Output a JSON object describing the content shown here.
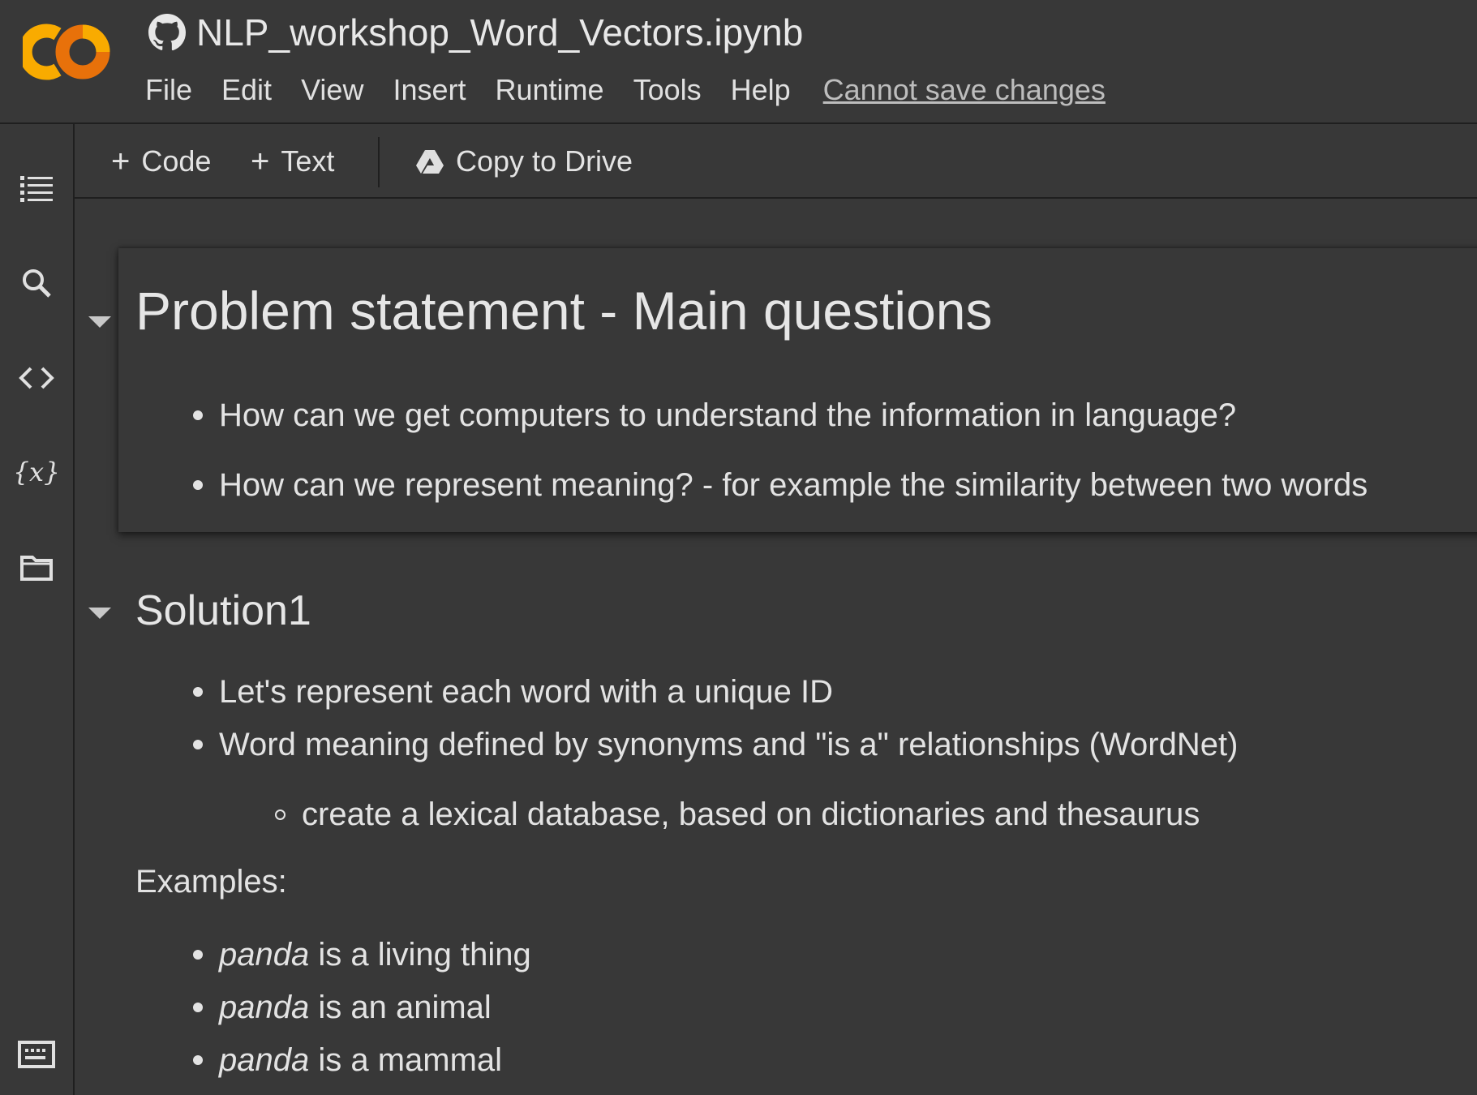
{
  "header": {
    "notebook_title": "NLP_workshop_Word_Vectors.ipynb",
    "logo_icon": "colab-logo-icon",
    "repo_icon": "github-icon",
    "menu": [
      "File",
      "Edit",
      "View",
      "Insert",
      "Runtime",
      "Tools",
      "Help"
    ],
    "save_status": "Cannot save changes"
  },
  "toolbar": {
    "code_label": "Code",
    "text_label": "Text",
    "drive_label": "Copy to Drive",
    "plus_glyph": "+"
  },
  "sidebar": {
    "icons": [
      "table-of-contents-icon",
      "search-icon",
      "code-snippets-icon",
      "variables-icon",
      "files-icon",
      "terminal-icon"
    ]
  },
  "cells": {
    "heading1": "Problem statement - Main questions",
    "questions": [
      "How can we get computers to understand the information in language?",
      "How can we represent meaning? - for example the similarity between two words"
    ],
    "heading2": "Solution1",
    "solution_points": [
      "Let's represent each word with a unique ID",
      "Word meaning defined by synonyms and \"is a\" relationships (WordNet)"
    ],
    "sub_point": "create a lexical database, based on dictionaries and thesaurus",
    "examples_label": "Examples:",
    "examples": [
      {
        "subject": "panda",
        "rest": " is a living thing"
      },
      {
        "subject": "panda",
        "rest": " is an animal"
      },
      {
        "subject": "panda",
        "rest": " is a mammal"
      }
    ]
  },
  "colors": {
    "background": "#383838",
    "divider": "#1f1f1f",
    "text": "#e3e3e3",
    "logo_orange": "#F9AB00",
    "logo_dark_orange": "#E8710A"
  }
}
